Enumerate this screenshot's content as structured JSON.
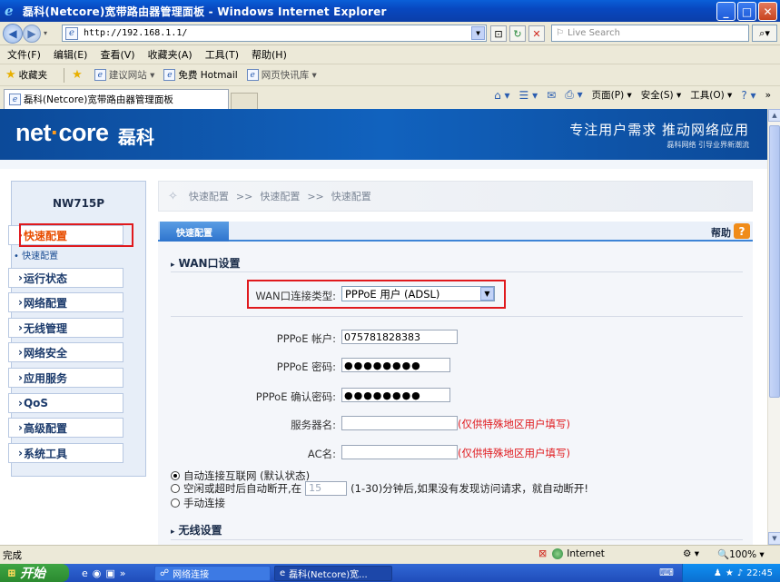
{
  "window": {
    "title": "磊科(Netcore)宽带路由器管理面板 - Windows Internet Explorer"
  },
  "address": {
    "url": "http://192.168.1.1/",
    "search_placeholder": "Live Search"
  },
  "menu": [
    "文件(F)",
    "编辑(E)",
    "查看(V)",
    "收藏夹(A)",
    "工具(T)",
    "帮助(H)"
  ],
  "favorites": {
    "label": "收藏夹",
    "items": [
      "建议网站 ▾",
      "免费 Hotmail",
      "网页快讯库 ▾"
    ]
  },
  "tab": {
    "title": "磊科(Netcore)宽带路由器管理面板"
  },
  "command_bar": {
    "page": "页面(P) ▾",
    "safety": "安全(S) ▾",
    "tools": "工具(O) ▾"
  },
  "site": {
    "logo_net": "net",
    "logo_dot": "·",
    "logo_core": "core",
    "logo_cn": "磊科",
    "slogan": "专注用户需求   推动网络应用",
    "sub_slogan": "磊科网络 引导业界新潮流"
  },
  "sidebar": {
    "model": "NW715P",
    "items": [
      {
        "label": "快速配置"
      },
      {
        "label": "运行状态"
      },
      {
        "label": "网络配置"
      },
      {
        "label": "无线管理"
      },
      {
        "label": "网络安全"
      },
      {
        "label": "应用服务"
      },
      {
        "label": "QoS"
      },
      {
        "label": "高级配置"
      },
      {
        "label": "系统工具"
      }
    ],
    "sub_item": "快速配置"
  },
  "breadcrumb": [
    "快速配置",
    "快速配置",
    "快速配置"
  ],
  "breadcrumb_sep": ">>",
  "panel": {
    "tab_label": "快速配置",
    "help_label": "帮助",
    "help_icon": "?"
  },
  "wan": {
    "section_title": "WAN口设置",
    "type_label": "WAN口连接类型:",
    "type_value": "PPPoE 用户 (ADSL)",
    "account_label": "PPPoE 帐户:",
    "account_value": "075781828383",
    "password_label": "PPPoE 密码:",
    "password_value": "●●●●●●●●",
    "confirm_label": "PPPoE 确认密码:",
    "confirm_value": "●●●●●●●●",
    "server_label": "服务器名:",
    "server_hint": "(仅供特殊地区用户填写)",
    "ac_label": "AC名:",
    "ac_hint": "(仅供特殊地区用户填写)"
  },
  "connect": {
    "auto": "自动连接互联网 (默认状态)",
    "idle_prefix": "空闲或超时后自动断开,在",
    "idle_value": "15",
    "idle_suffix": "(1-30)分钟后,如果没有发现访问请求，就自动断开!",
    "manual": "手动连接"
  },
  "wireless": {
    "section_title": "无线设置"
  },
  "status": {
    "text": "完成",
    "zone": "Internet",
    "zoom": "100% ▾"
  },
  "taskbar": {
    "start": "开始",
    "tasks": [
      "网络连接",
      "磊科(Netcore)宽..."
    ],
    "time": "22:45"
  },
  "colors": {
    "accent": "#3d84d6",
    "header": "#1162be",
    "highlight": "#e0191d",
    "active_nav": "#e84d00"
  }
}
